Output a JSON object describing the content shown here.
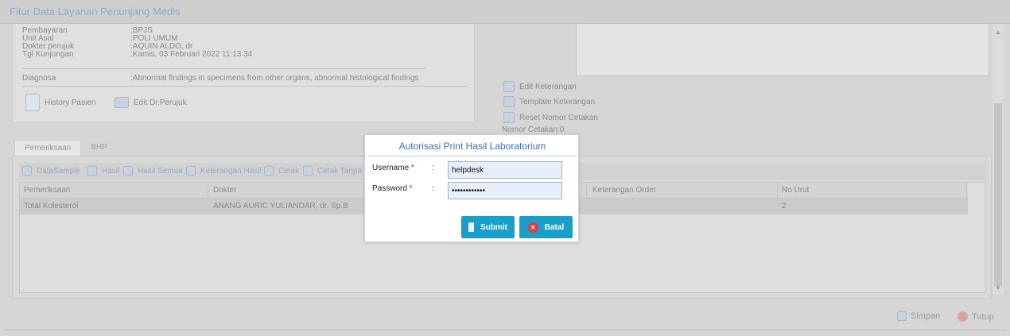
{
  "window": {
    "title": "Fitur Data Layanan Penunjang Medis"
  },
  "patient_info": [
    {
      "label": "Pembayaran",
      "value": ":BPJS"
    },
    {
      "label": "Unit Asal",
      "value": ":POLI UMUM"
    },
    {
      "label": "Dokter perujuk",
      "value": ":AQUIN ALDO, dr"
    },
    {
      "label": "Tgl Kunjungan",
      "value": ":Kamis, 03 Februari 2022 11:13:34"
    }
  ],
  "diagnosa": {
    "label": "Diagnosa",
    "value": ":Abnormal findings in specimens from other organs, abnormal histological findings"
  },
  "left_actions": {
    "history": "History Pasien",
    "edit_perujuk": "Edit Dr.Perujuk"
  },
  "right_actions": {
    "edit_keterangan": "Edit Keterangan",
    "template_keterangan": "Template Keterangan",
    "reset_nomor": "Reset Nomor Cetakan",
    "nomor_cetakan": "Nomor Cetakan:0"
  },
  "tabs": [
    {
      "label": "Pemeriksaan",
      "active": true
    },
    {
      "label": "BHP",
      "active": false
    }
  ],
  "grid_toolbar": [
    "DataSample",
    "Hasil",
    "Hasil Semua",
    "Keterangan Hasil",
    "Cetak",
    "Cetak Tanpa K"
  ],
  "grid": {
    "columns": [
      "Pemeriksaan",
      "Dokter",
      "Keterangan Order",
      "No Urut"
    ],
    "rows": [
      {
        "pemeriksaan": "Total Kolesterol",
        "dokter": "ANANG AURIC YULIANDAR, dr. Sp.B",
        "keterangan": "",
        "no_urut": "2"
      }
    ]
  },
  "footer": {
    "simpan": "Simpan",
    "tutup": "Tutup"
  },
  "modal": {
    "title": "Autorisasi Print Hasil Laboratorium",
    "username_label": "Username",
    "password_label": "Password",
    "required_mark": "*",
    "colon": ":",
    "username_value": "helpdesk",
    "password_value": "kolesterol12",
    "submit_label": "Submit",
    "cancel_label": "Batal"
  },
  "colors": {
    "accent": "#1aa0c8",
    "title_blue": "#3a6fb5",
    "danger": "#e23b3b"
  },
  "icons": [
    "history-icon",
    "edit-user-icon",
    "edit-doc-icon",
    "template-icon",
    "printer-icon",
    "save-icon",
    "close-icon"
  ]
}
